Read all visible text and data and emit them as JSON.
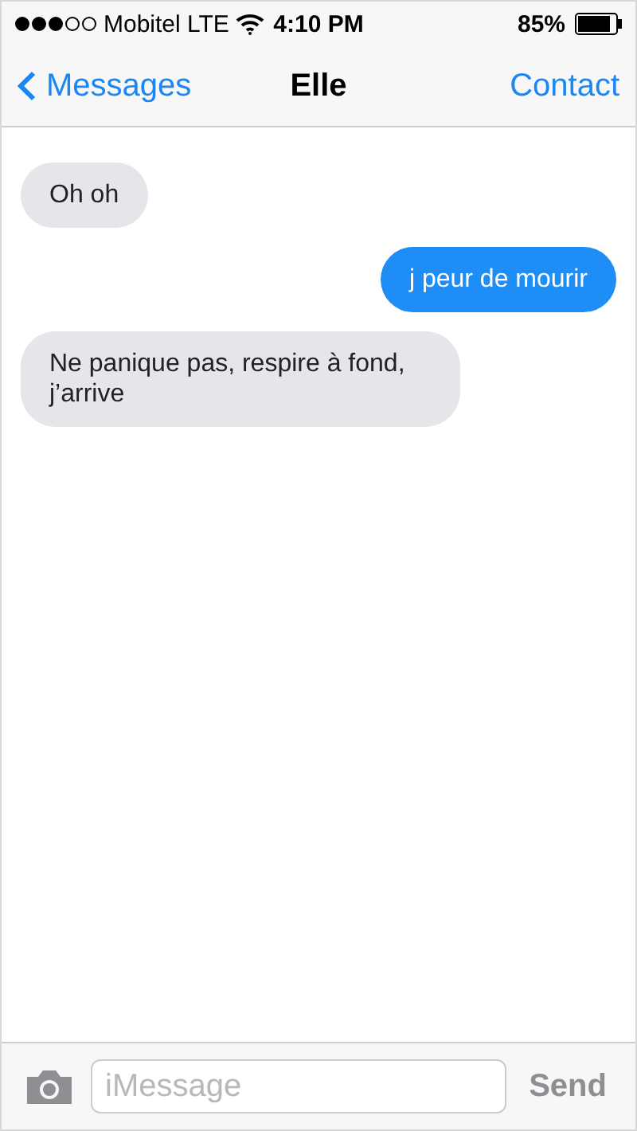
{
  "status_bar": {
    "carrier": "Mobitel LTE",
    "time": "4:10 PM",
    "battery": "85%"
  },
  "nav": {
    "back": "Messages",
    "title": "Elle",
    "action": "Contact"
  },
  "messages": [
    {
      "kind": "received",
      "text": "Oh oh"
    },
    {
      "kind": "sent",
      "text": "j peur de mourir"
    },
    {
      "kind": "received",
      "text": "Ne panique pas, respire à fond, j’arrive"
    }
  ],
  "composer": {
    "placeholder": "iMessage",
    "send": "Send",
    "send_disabled": true
  }
}
